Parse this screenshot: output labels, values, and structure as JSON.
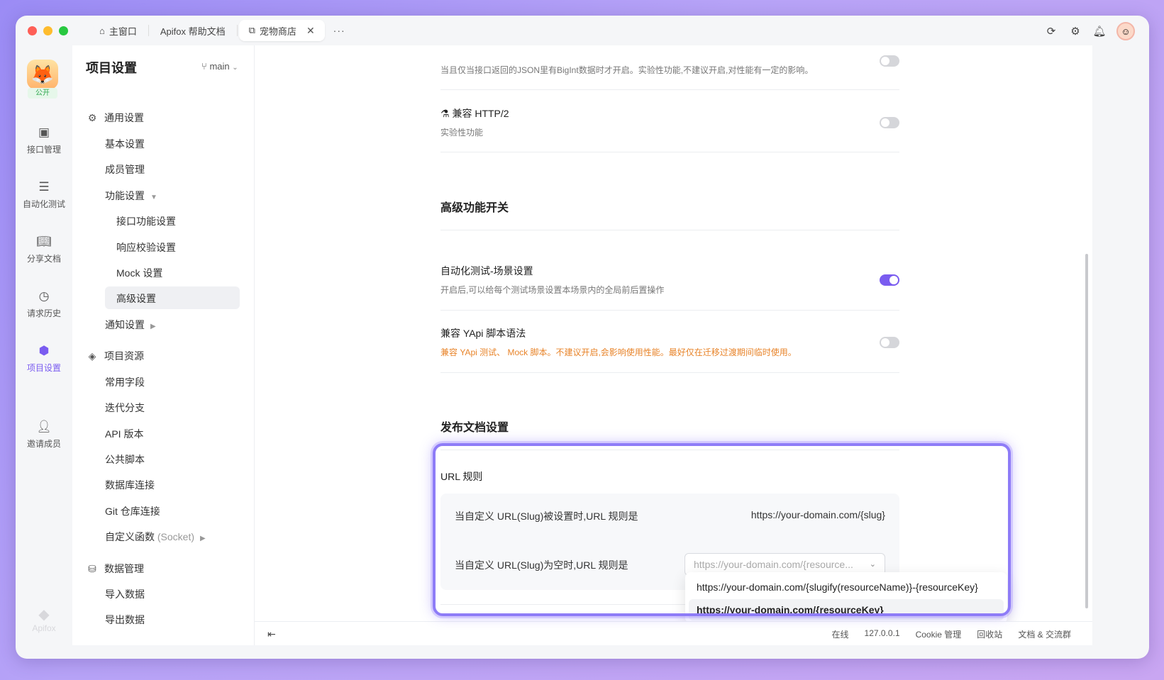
{
  "titlebar": {
    "tabs": [
      {
        "label": "主窗口",
        "icon": "home-icon"
      },
      {
        "label": "Apifox 帮助文档"
      },
      {
        "label": "宠物商店",
        "icon": "external-link-icon",
        "active": true
      }
    ],
    "more": "···"
  },
  "rail": {
    "project_badge": "公开",
    "items": [
      {
        "label": "接口管理",
        "icon": "api-icon"
      },
      {
        "label": "自动化测试",
        "icon": "automation-icon"
      },
      {
        "label": "分享文档",
        "icon": "book-icon"
      },
      {
        "label": "请求历史",
        "icon": "clock-icon"
      },
      {
        "label": "项目设置",
        "icon": "hexagon-settings-icon",
        "active": true
      },
      {
        "label": "邀请成员",
        "icon": "user-plus-icon"
      }
    ],
    "brand": "Apifox"
  },
  "nav": {
    "title": "项目设置",
    "branch": "main",
    "sections": [
      {
        "label": "通用设置"
      },
      {
        "label": "项目资源"
      },
      {
        "label": "数据管理"
      }
    ],
    "items": {
      "basic": "基本设置",
      "members": "成员管理",
      "features": "功能设置",
      "api_features": "接口功能设置",
      "response_validation": "响应校验设置",
      "mock": "Mock 设置",
      "advanced": "高级设置",
      "notifications": "通知设置",
      "common_fields": "常用字段",
      "iteration_branch": "迭代分支",
      "api_version": "API 版本",
      "public_scripts": "公共脚本",
      "db_connection": "数据库连接",
      "git_connection": "Git 仓库连接",
      "custom_functions": "自定义函数",
      "custom_functions_suffix": "(Socket)",
      "import_data": "导入数据",
      "export_data": "导出数据"
    }
  },
  "main": {
    "bigint_desc": "当且仅当接口返回的JSON里有BigInt数据时才开启。实验性功能,不建议开启,对性能有一定的影响。",
    "http2_title": "兼容 HTTP/2",
    "http2_desc": "实验性功能",
    "advanced_header": "高级功能开关",
    "scene_title": "自动化测试-场景设置",
    "scene_desc": "开启后,可以给每个测试场景设置本场景内的全局前后置操作",
    "yapi_title": "兼容 YApi 脚本语法",
    "yapi_desc": "兼容 YApi 测试、 Mock 脚本。不建议开启,会影响使用性能。最好仅在迁移过渡期间临时使用。",
    "publish_header": "发布文档设置",
    "url_rule_label": "URL 规则",
    "slug_set_label": "当自定义 URL(Slug)被设置时,URL 规则是",
    "slug_set_value": "https://your-domain.com/{slug}",
    "slug_empty_label": "当自定义 URL(Slug)为空时,URL 规则是",
    "slug_empty_select": "https://your-domain.com/{resource...",
    "dropdown_options": [
      "https://your-domain.com/{slugify(resourceName)}-{resourceKey}",
      "https://your-domain.com/{resourceKey}"
    ]
  },
  "toggles": {
    "bigint": false,
    "http2": false,
    "scene": true,
    "yapi": false
  },
  "statusbar": {
    "items": [
      "在线",
      "127.0.0.1",
      "Cookie 管理",
      "回收站",
      "文档 & 交流群"
    ]
  }
}
